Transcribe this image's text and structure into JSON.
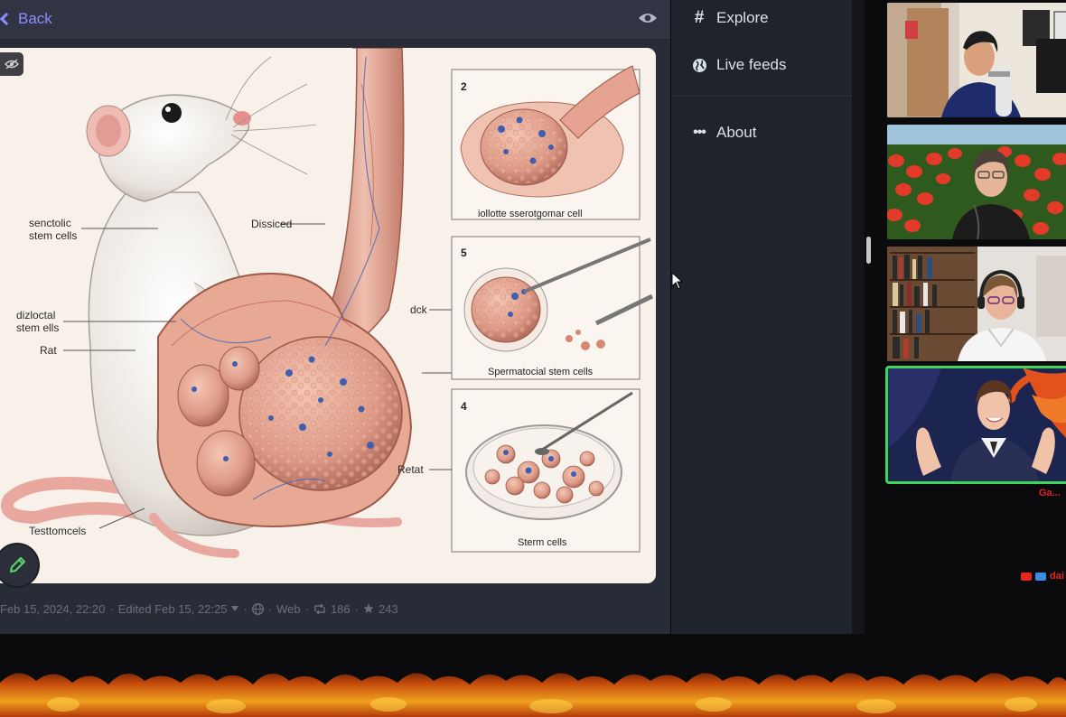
{
  "header": {
    "back_label": "Back"
  },
  "illustration": {
    "labels": {
      "senctolic": "senctolic",
      "stem_cells": "stem cells",
      "dissiced": "Dissiced",
      "dizloctal": "dizloctal",
      "stem_ells": "stem ells",
      "rat": "Rat",
      "testomcels": "Testtomcels",
      "dck": "dck",
      "retat": "Retat"
    },
    "panels": [
      {
        "number": "2",
        "caption": "iollotte sserotgomar cell"
      },
      {
        "number": "5",
        "caption": "Spermatocial stem cells"
      },
      {
        "number": "4",
        "caption": "Sterm cells"
      }
    ]
  },
  "post_meta": {
    "date": "Feb 15, 2024, 22:20",
    "edited": "Edited Feb 15, 22:25",
    "visibility": "Web",
    "boosts": "186",
    "favourites": "243"
  },
  "nav": {
    "explore": "Explore",
    "live_feeds": "Live feeds",
    "about": "About"
  },
  "stream": {
    "speaker_name": "Ga...",
    "user_label": "dai"
  },
  "colors": {
    "accent": "#8c8dff",
    "active_speaker": "#3fd45a",
    "overlay_text": "#e4241d"
  }
}
